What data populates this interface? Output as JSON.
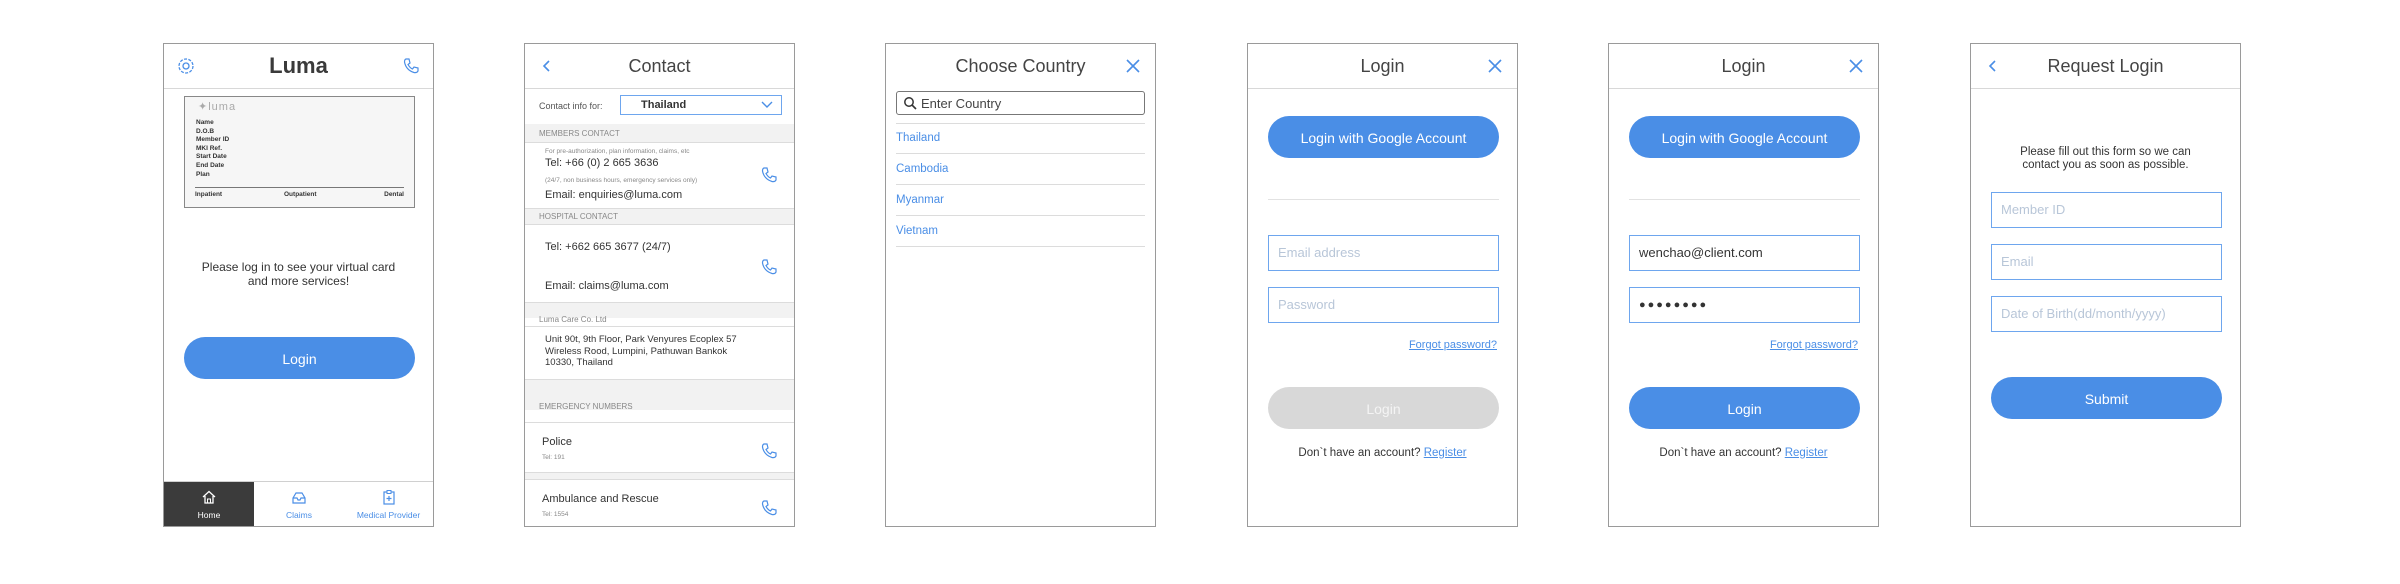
{
  "colors": {
    "accent": "#4a8ee6",
    "border": "#9a9a9a",
    "disabled": "#d8d8d8",
    "text": "#333333"
  },
  "home": {
    "brand": "Luma",
    "settings_icon": "gear-icon",
    "phone_icon": "phone-icon",
    "card": {
      "logo": "✦luma",
      "fields": [
        "Name",
        "D.O.B",
        "Member ID",
        "MKI Ref.",
        "Start Date",
        "End Date",
        "Plan"
      ],
      "categories": [
        "Inpatient",
        "Outpatient",
        "Dental"
      ]
    },
    "message_line1": "Please log in to see your virtual card",
    "message_line2": "and more services!",
    "login_label": "Login",
    "tabs": [
      {
        "label": "Home",
        "icon": "home-icon"
      },
      {
        "label": "Claims",
        "icon": "claims-icon"
      },
      {
        "label": "Medical Provider",
        "icon": "medical-provider-icon"
      }
    ]
  },
  "contact": {
    "title": "Contact",
    "info_label": "Contact info for:",
    "country": "Thailand",
    "members_section": "MEMBERS CONTACT",
    "members_note": "For pre-authorization, plan information, claims, etc",
    "members_tel": "Tel: +66 (0) 2 665 3636",
    "members_hours": "(24/7, non business hours, emergency services only)",
    "members_email": "Email: enquiries@luma.com",
    "hospital_section": "HOSPITAL CONTACT",
    "hospital_tel": "Tel: +662 665 3677 (24/7)",
    "hospital_email": "Email: claims@luma.com",
    "company_section": "Luma Care Co. Ltd",
    "address_line1": "Unit 90t, 9th Floor, Park Venyures Ecoplex 57",
    "address_line2": "Wireless Rood, Lumpini, Pathuwan Bankok",
    "address_line3": "10330, Thailand",
    "emergency_section": "EMERGENCY NUMBERS",
    "police_label": "Police",
    "police_tel": "Tel: 191",
    "ambulance_label": "Ambulance and Rescue",
    "ambulance_tel": "Tel: 1554"
  },
  "choose_country": {
    "title": "Choose Country",
    "search_placeholder": "Enter Country",
    "countries": [
      "Thailand",
      "Cambodia",
      "Myanmar",
      "Vietnam"
    ]
  },
  "login_empty": {
    "title": "Login",
    "google_label": "Login with Google Account",
    "email_placeholder": "Email address",
    "password_placeholder": "Password",
    "forgot_label": "Forgot password?",
    "login_label": "Login",
    "no_account": "Don`t have an account?",
    "register_label": "Register"
  },
  "login_filled": {
    "title": "Login",
    "google_label": "Login with Google Account",
    "email_value": "wenchao@client.com",
    "password_value": "●●●●●●●●",
    "forgot_label": "Forgot password?",
    "login_label": "Login",
    "no_account": "Don`t have an account?",
    "register_label": "Register"
  },
  "request_login": {
    "title": "Request Login",
    "instructions_line1": "Please fill out this form so we can",
    "instructions_line2": "contact you as soon as possible.",
    "member_id_placeholder": "Member ID",
    "email_placeholder": "Email",
    "dob_placeholder": "Date of Birth(dd/month/yyyy)",
    "submit_label": "Submit"
  }
}
